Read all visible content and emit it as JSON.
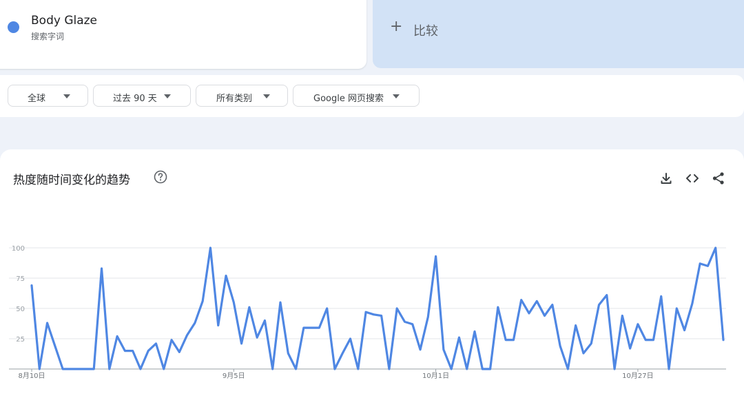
{
  "term": {
    "name": "Body Glaze",
    "type": "搜索字词",
    "color": "#4f87e3"
  },
  "compare": {
    "label": "比较"
  },
  "filters": {
    "region": "全球",
    "time": "过去 90 天",
    "category": "所有类别",
    "property": "Google 网页搜索"
  },
  "chart_header": {
    "title": "热度随时间变化的趋势",
    "help_icon": "help-circle-icon",
    "download_icon": "download-icon",
    "embed_icon": "code-icon",
    "share_icon": "share-icon"
  },
  "chart_data": {
    "type": "line",
    "ylim": [
      0,
      100
    ],
    "yticks": [
      100,
      75,
      50,
      25
    ],
    "xtick_labels": [
      "8月10日",
      "9月5日",
      "10月1日",
      "10月27日"
    ],
    "xtick_index": [
      0,
      26,
      52,
      78
    ],
    "grid": true,
    "series": [
      {
        "name": "Body Glaze",
        "color": "#4f87e3",
        "values": [
          69,
          0,
          38,
          19,
          0,
          0,
          0,
          0,
          0,
          83,
          0,
          27,
          15,
          15,
          0,
          15,
          21,
          0,
          24,
          14,
          28,
          38,
          56,
          100,
          36,
          77,
          55,
          21,
          51,
          26,
          40,
          0,
          55,
          13,
          0,
          34,
          34,
          34,
          50,
          0,
          13,
          25,
          0,
          47,
          45,
          44,
          0,
          50,
          39,
          37,
          16,
          43,
          93,
          16,
          0,
          26,
          0,
          31,
          0,
          0,
          51,
          24,
          24,
          57,
          46,
          56,
          44,
          53,
          19,
          0,
          36,
          13,
          21,
          53,
          61,
          0,
          44,
          17,
          37,
          24,
          24,
          60,
          0,
          50,
          32,
          54,
          87,
          85,
          100,
          24
        ]
      }
    ]
  }
}
